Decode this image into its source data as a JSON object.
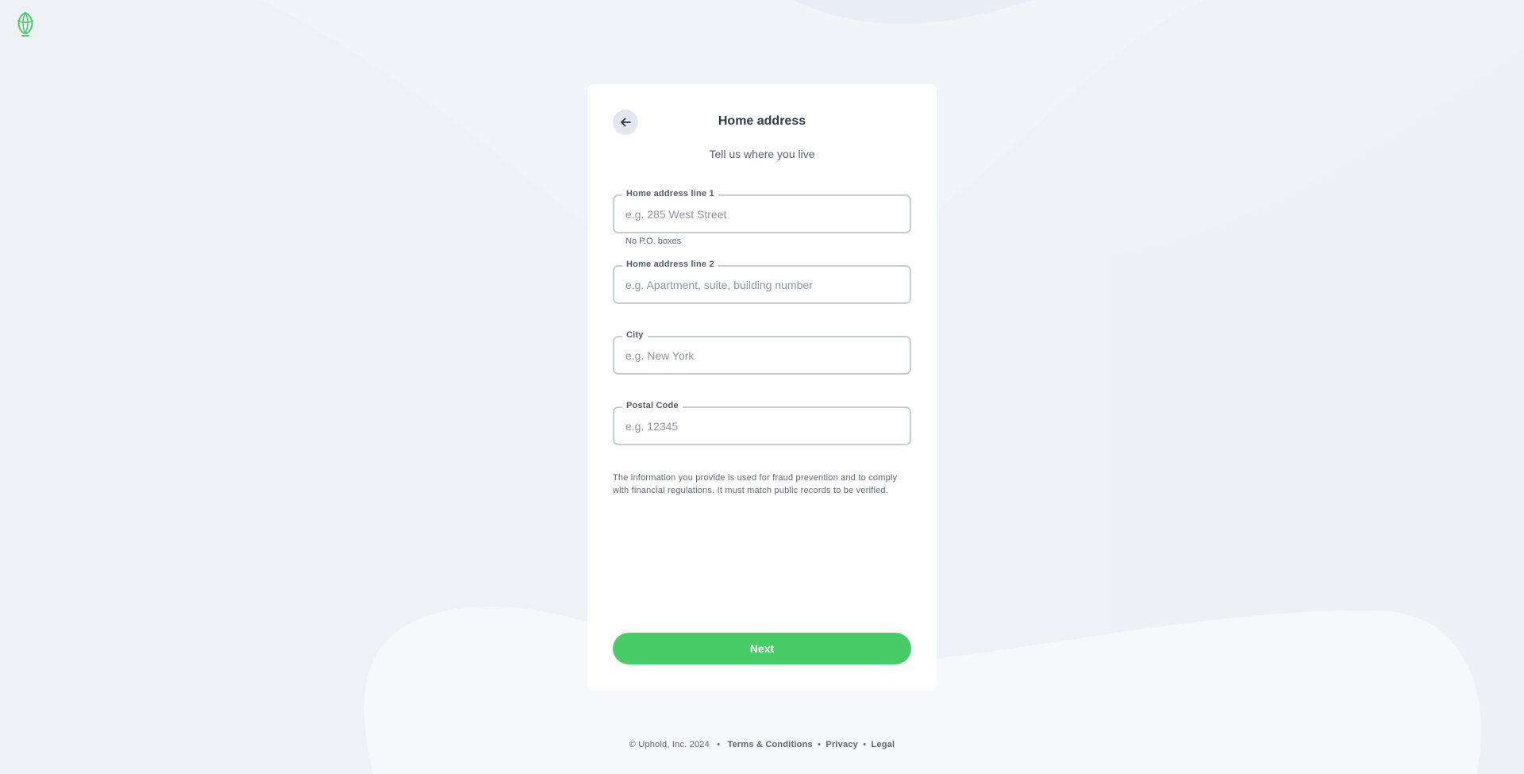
{
  "page": {
    "title": "Home address",
    "subtitle": "Tell us where you live"
  },
  "form": {
    "address1": {
      "label": "Home address line 1",
      "placeholder": "e.g. 285 West Street",
      "hint": "No P.O. boxes",
      "value": ""
    },
    "address2": {
      "label": "Home address line 2",
      "placeholder": "e.g. Apartment, suite, building number",
      "value": ""
    },
    "city": {
      "label": "City",
      "placeholder": "e.g. New York",
      "value": ""
    },
    "postal": {
      "label": "Postal Code",
      "placeholder": "e.g. 12345",
      "value": ""
    }
  },
  "disclaimer": "The information you provide is used for fraud prevention and to comply with financial regulations. It must match public records to be verified.",
  "next_label": "Next",
  "footer": {
    "copyright": "© Uphold, Inc. 2024",
    "separator": "•",
    "links": [
      "Terms & Conditions",
      "Privacy",
      "Legal"
    ]
  },
  "icons": {
    "logo": "uphold-logo-icon",
    "back": "arrow-left-icon"
  },
  "colors": {
    "brand_green": "#49cc68",
    "background": "#f1f4f8",
    "card": "#ffffff",
    "back_button": "#e3e8f0"
  }
}
